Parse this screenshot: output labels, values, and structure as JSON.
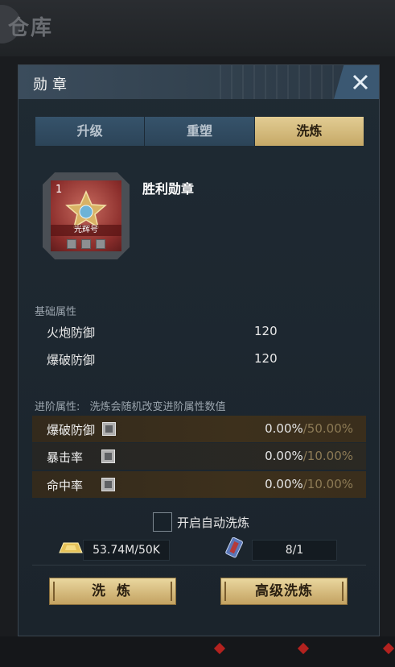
{
  "background": {
    "title": "仓库"
  },
  "panel": {
    "title": "勋章"
  },
  "tabs": [
    {
      "label": "升级",
      "active": false
    },
    {
      "label": "重塑",
      "active": false
    },
    {
      "label": "洗炼",
      "active": true
    }
  ],
  "medal": {
    "level": "1",
    "ribbon_text": "光辉号",
    "name": "胜利勋章",
    "slots": 3
  },
  "base_attributes": {
    "label": "基础属性",
    "rows": [
      {
        "name": "火炮防御",
        "value": "120"
      },
      {
        "name": "爆破防御",
        "value": "120"
      }
    ]
  },
  "advanced_attributes": {
    "label": "进阶属性:",
    "hint": "洗炼会随机改变进阶属性数值",
    "rows": [
      {
        "name": "爆破防御",
        "current": "0.00%",
        "max": "/50.00%"
      },
      {
        "name": "暴击率",
        "current": "0.00%",
        "max": "/10.00%"
      },
      {
        "name": "命中率",
        "current": "0.00%",
        "max": "/10.00%"
      }
    ]
  },
  "auto_refine": {
    "label": "开启自动洗炼",
    "checked": false
  },
  "costs": {
    "gold": "53.74M/50K",
    "scroll": "8/1"
  },
  "buttons": {
    "refine": "洗 炼",
    "advanced_refine": "高级洗炼"
  },
  "colors": {
    "accent_gold": "#d9c083",
    "tab_inactive": "#36536b",
    "panel_bg": "#1f2a33"
  }
}
